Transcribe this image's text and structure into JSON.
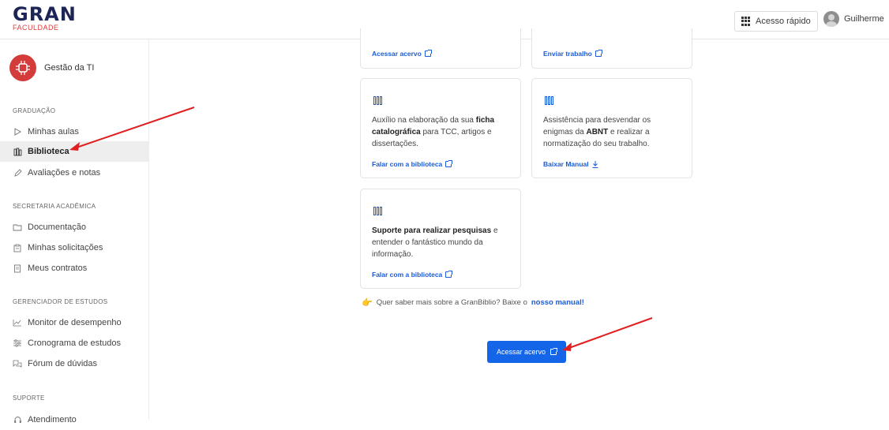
{
  "header": {
    "logo_main": "GRAN",
    "logo_sub": "FACULDADE",
    "quick_access": "Acesso rápido",
    "user_name": "Guilherme"
  },
  "sidebar": {
    "course_name": "Gestão da TI",
    "sections": [
      {
        "title": "GRADUAÇÃO",
        "items": [
          "Minhas aulas",
          "Biblioteca",
          "Avaliações e notas"
        ]
      },
      {
        "title": "SECRETARIA ACADÊMICA",
        "items": [
          "Documentação",
          "Minhas solicitações",
          "Meus contratos"
        ]
      },
      {
        "title": "GERENCIADOR DE ESTUDOS",
        "items": [
          "Monitor de desempenho",
          "Cronograma de estudos",
          "Fórum de dúvidas"
        ]
      },
      {
        "title": "SUPORTE",
        "items": [
          "Atendimento"
        ]
      }
    ]
  },
  "cards": {
    "top_left_link": "Acessar acervo",
    "top_right_link": "Enviar trabalho",
    "ficha": {
      "pre": "Auxílio na elaboração da sua ",
      "bold": "ficha catalográfica",
      "post": " para TCC, artigos e dissertações.",
      "link": "Falar com a biblioteca"
    },
    "abnt": {
      "pre": "Assistência para desvendar os enigmas da ",
      "bold": "ABNT",
      "post": " e realizar a normatização do seu trabalho.",
      "link": "Baixar Manual"
    },
    "pesquisa": {
      "bold": "Suporte para realizar pesquisas",
      "post": " e entender o fantástico mundo da informação.",
      "link": "Falar com a biblioteca"
    }
  },
  "info": {
    "text": "Quer saber mais sobre a GranBiblio? Baixe o",
    "link": "nosso manual!"
  },
  "primary_button": "Acessar acervo",
  "colors": {
    "accent": "#1565e8",
    "brand_navy": "#1d2557",
    "brand_red": "#e23a3a",
    "arrow": "#e02020"
  }
}
